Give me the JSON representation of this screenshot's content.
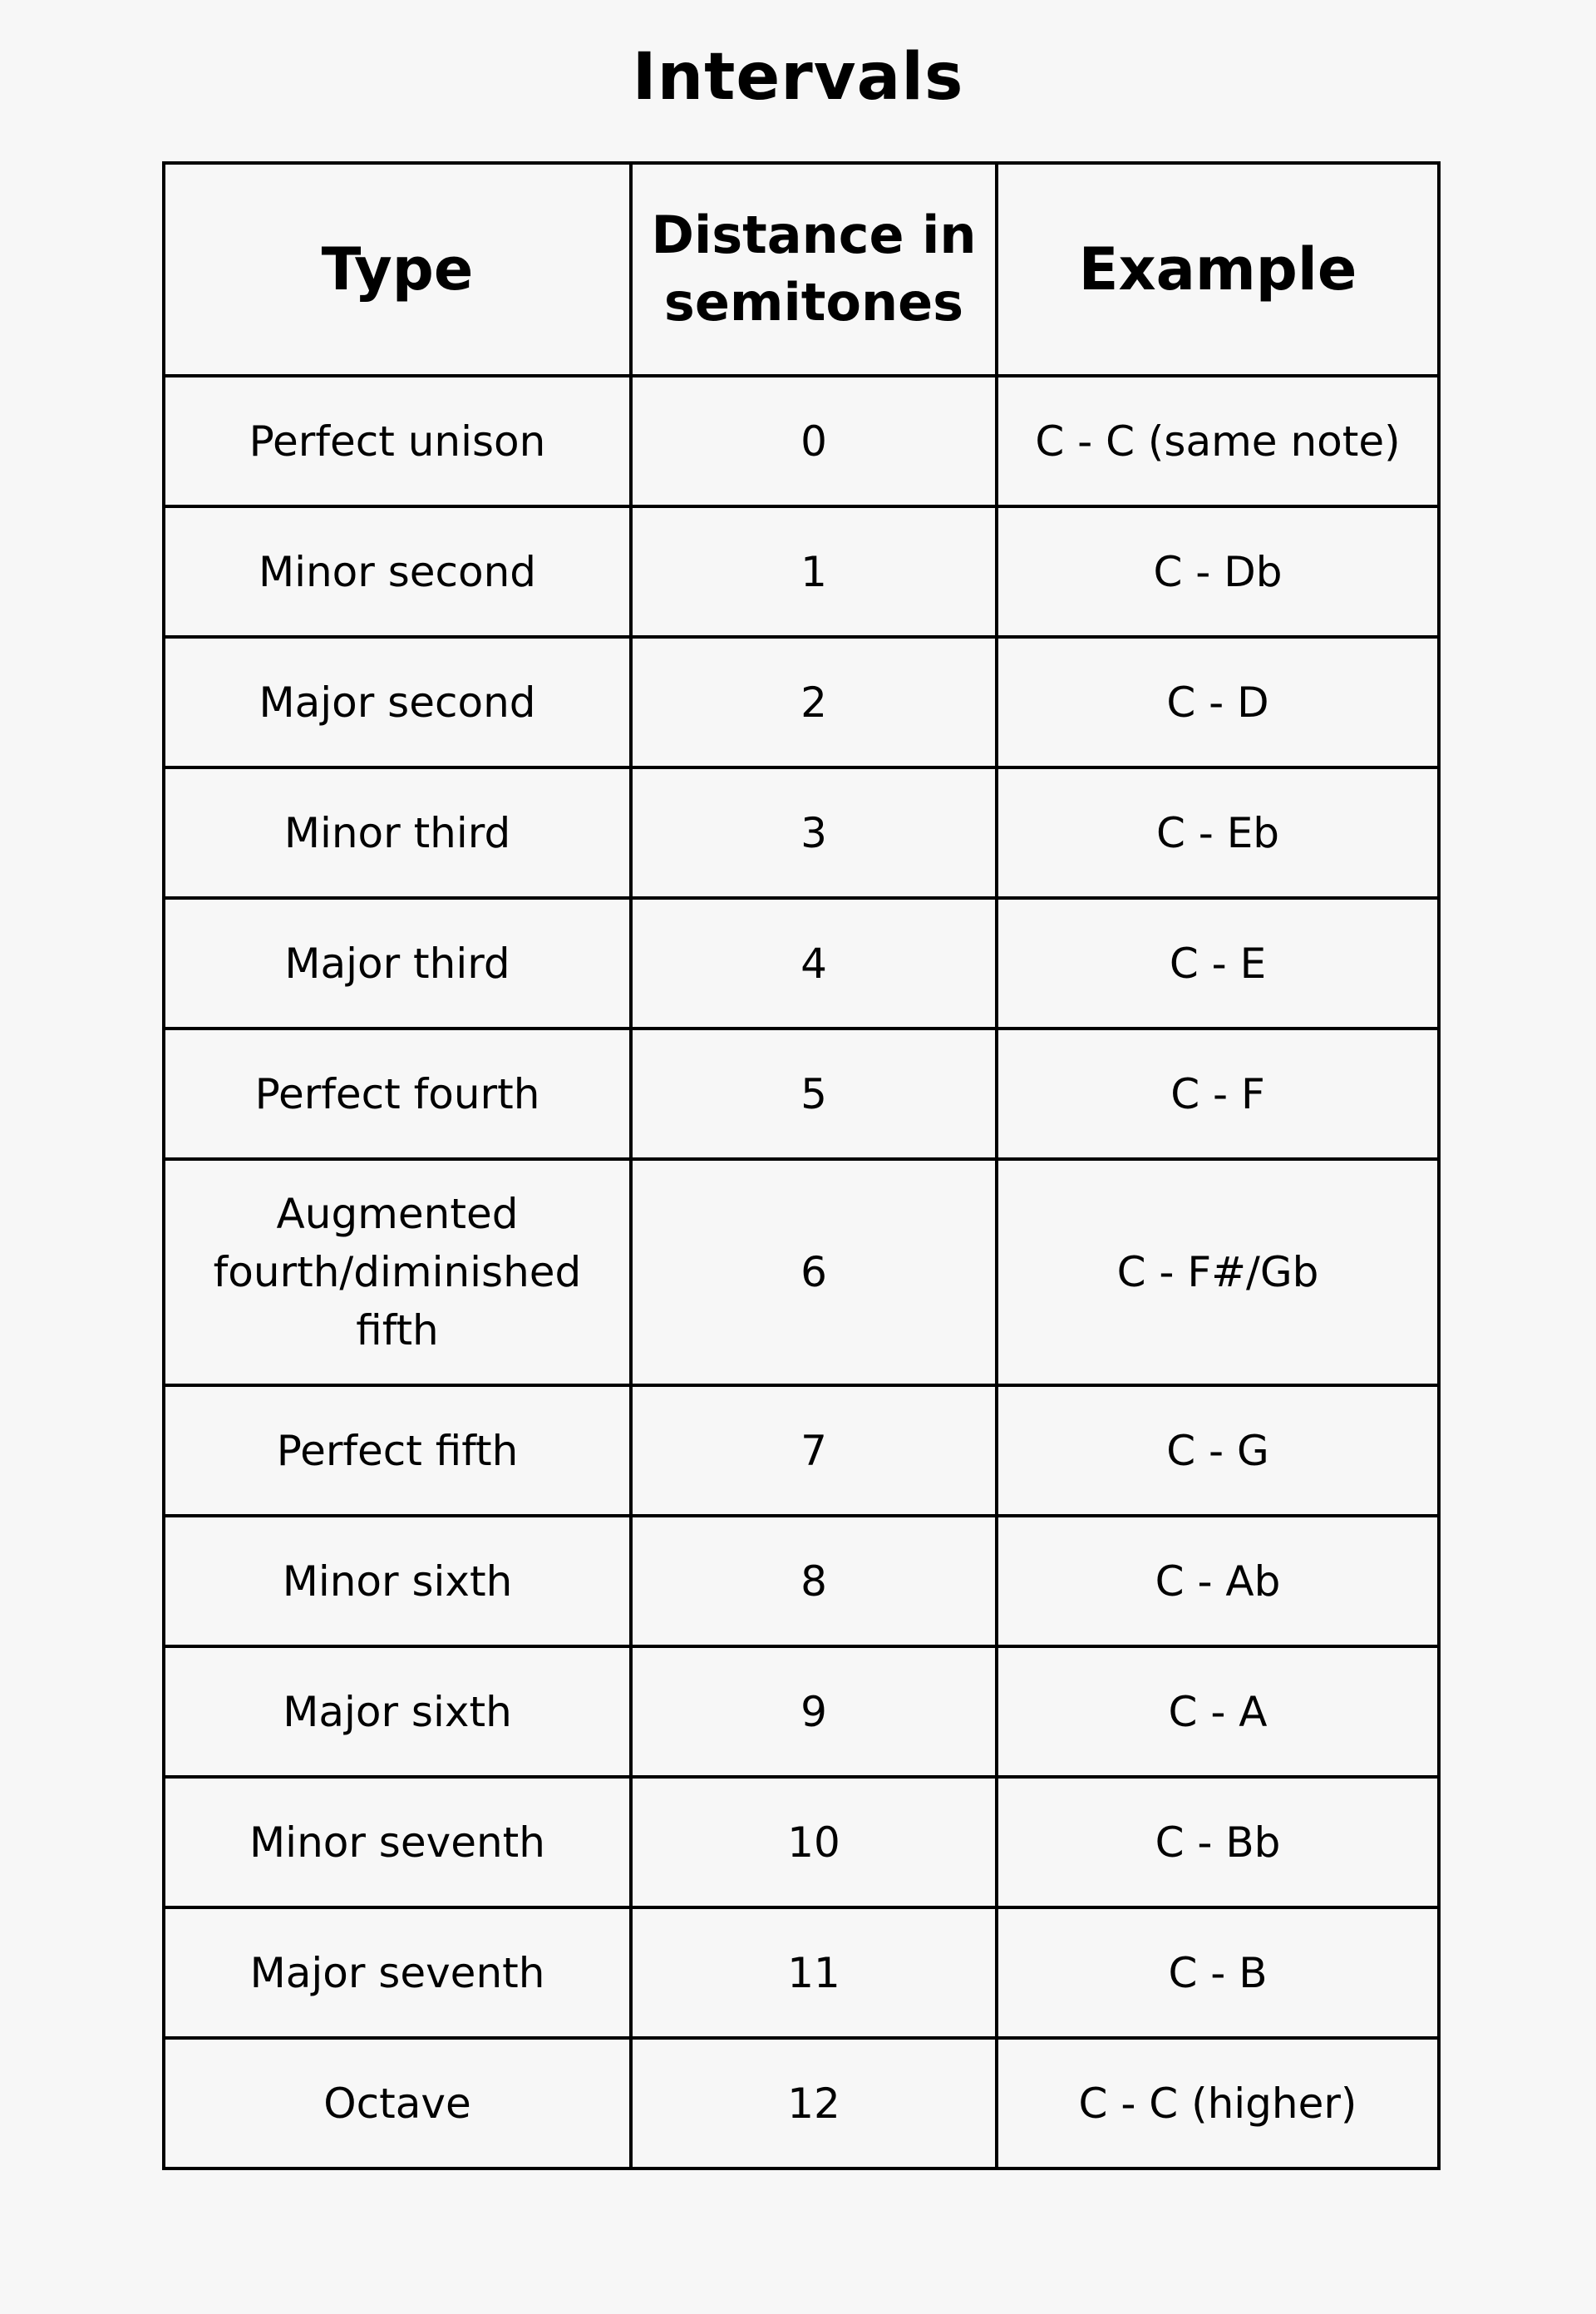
{
  "title": "Intervals",
  "table": {
    "headers": [
      "Type",
      "Distance in semitones",
      "Example"
    ],
    "rows": [
      {
        "type": "Perfect unison",
        "semitones": "0",
        "example": "C - C (same note)"
      },
      {
        "type": "Minor second",
        "semitones": "1",
        "example": "C - Db"
      },
      {
        "type": "Major second",
        "semitones": "2",
        "example": "C - D"
      },
      {
        "type": "Minor third",
        "semitones": "3",
        "example": "C - Eb"
      },
      {
        "type": "Major third",
        "semitones": "4",
        "example": "C - E"
      },
      {
        "type": "Perfect fourth",
        "semitones": "5",
        "example": "C - F"
      },
      {
        "type": "Augmented fourth/diminished fifth",
        "semitones": "6",
        "example": "C - F#/Gb"
      },
      {
        "type": "Perfect fifth",
        "semitones": "7",
        "example": "C - G"
      },
      {
        "type": "Minor sixth",
        "semitones": "8",
        "example": "C - Ab"
      },
      {
        "type": "Major sixth",
        "semitones": "9",
        "example": "C - A"
      },
      {
        "type": "Minor seventh",
        "semitones": "10",
        "example": "C - Bb"
      },
      {
        "type": "Major seventh",
        "semitones": "11",
        "example": "C - B"
      },
      {
        "type": "Octave",
        "semitones": "12",
        "example": "C - C (higher)"
      }
    ]
  }
}
